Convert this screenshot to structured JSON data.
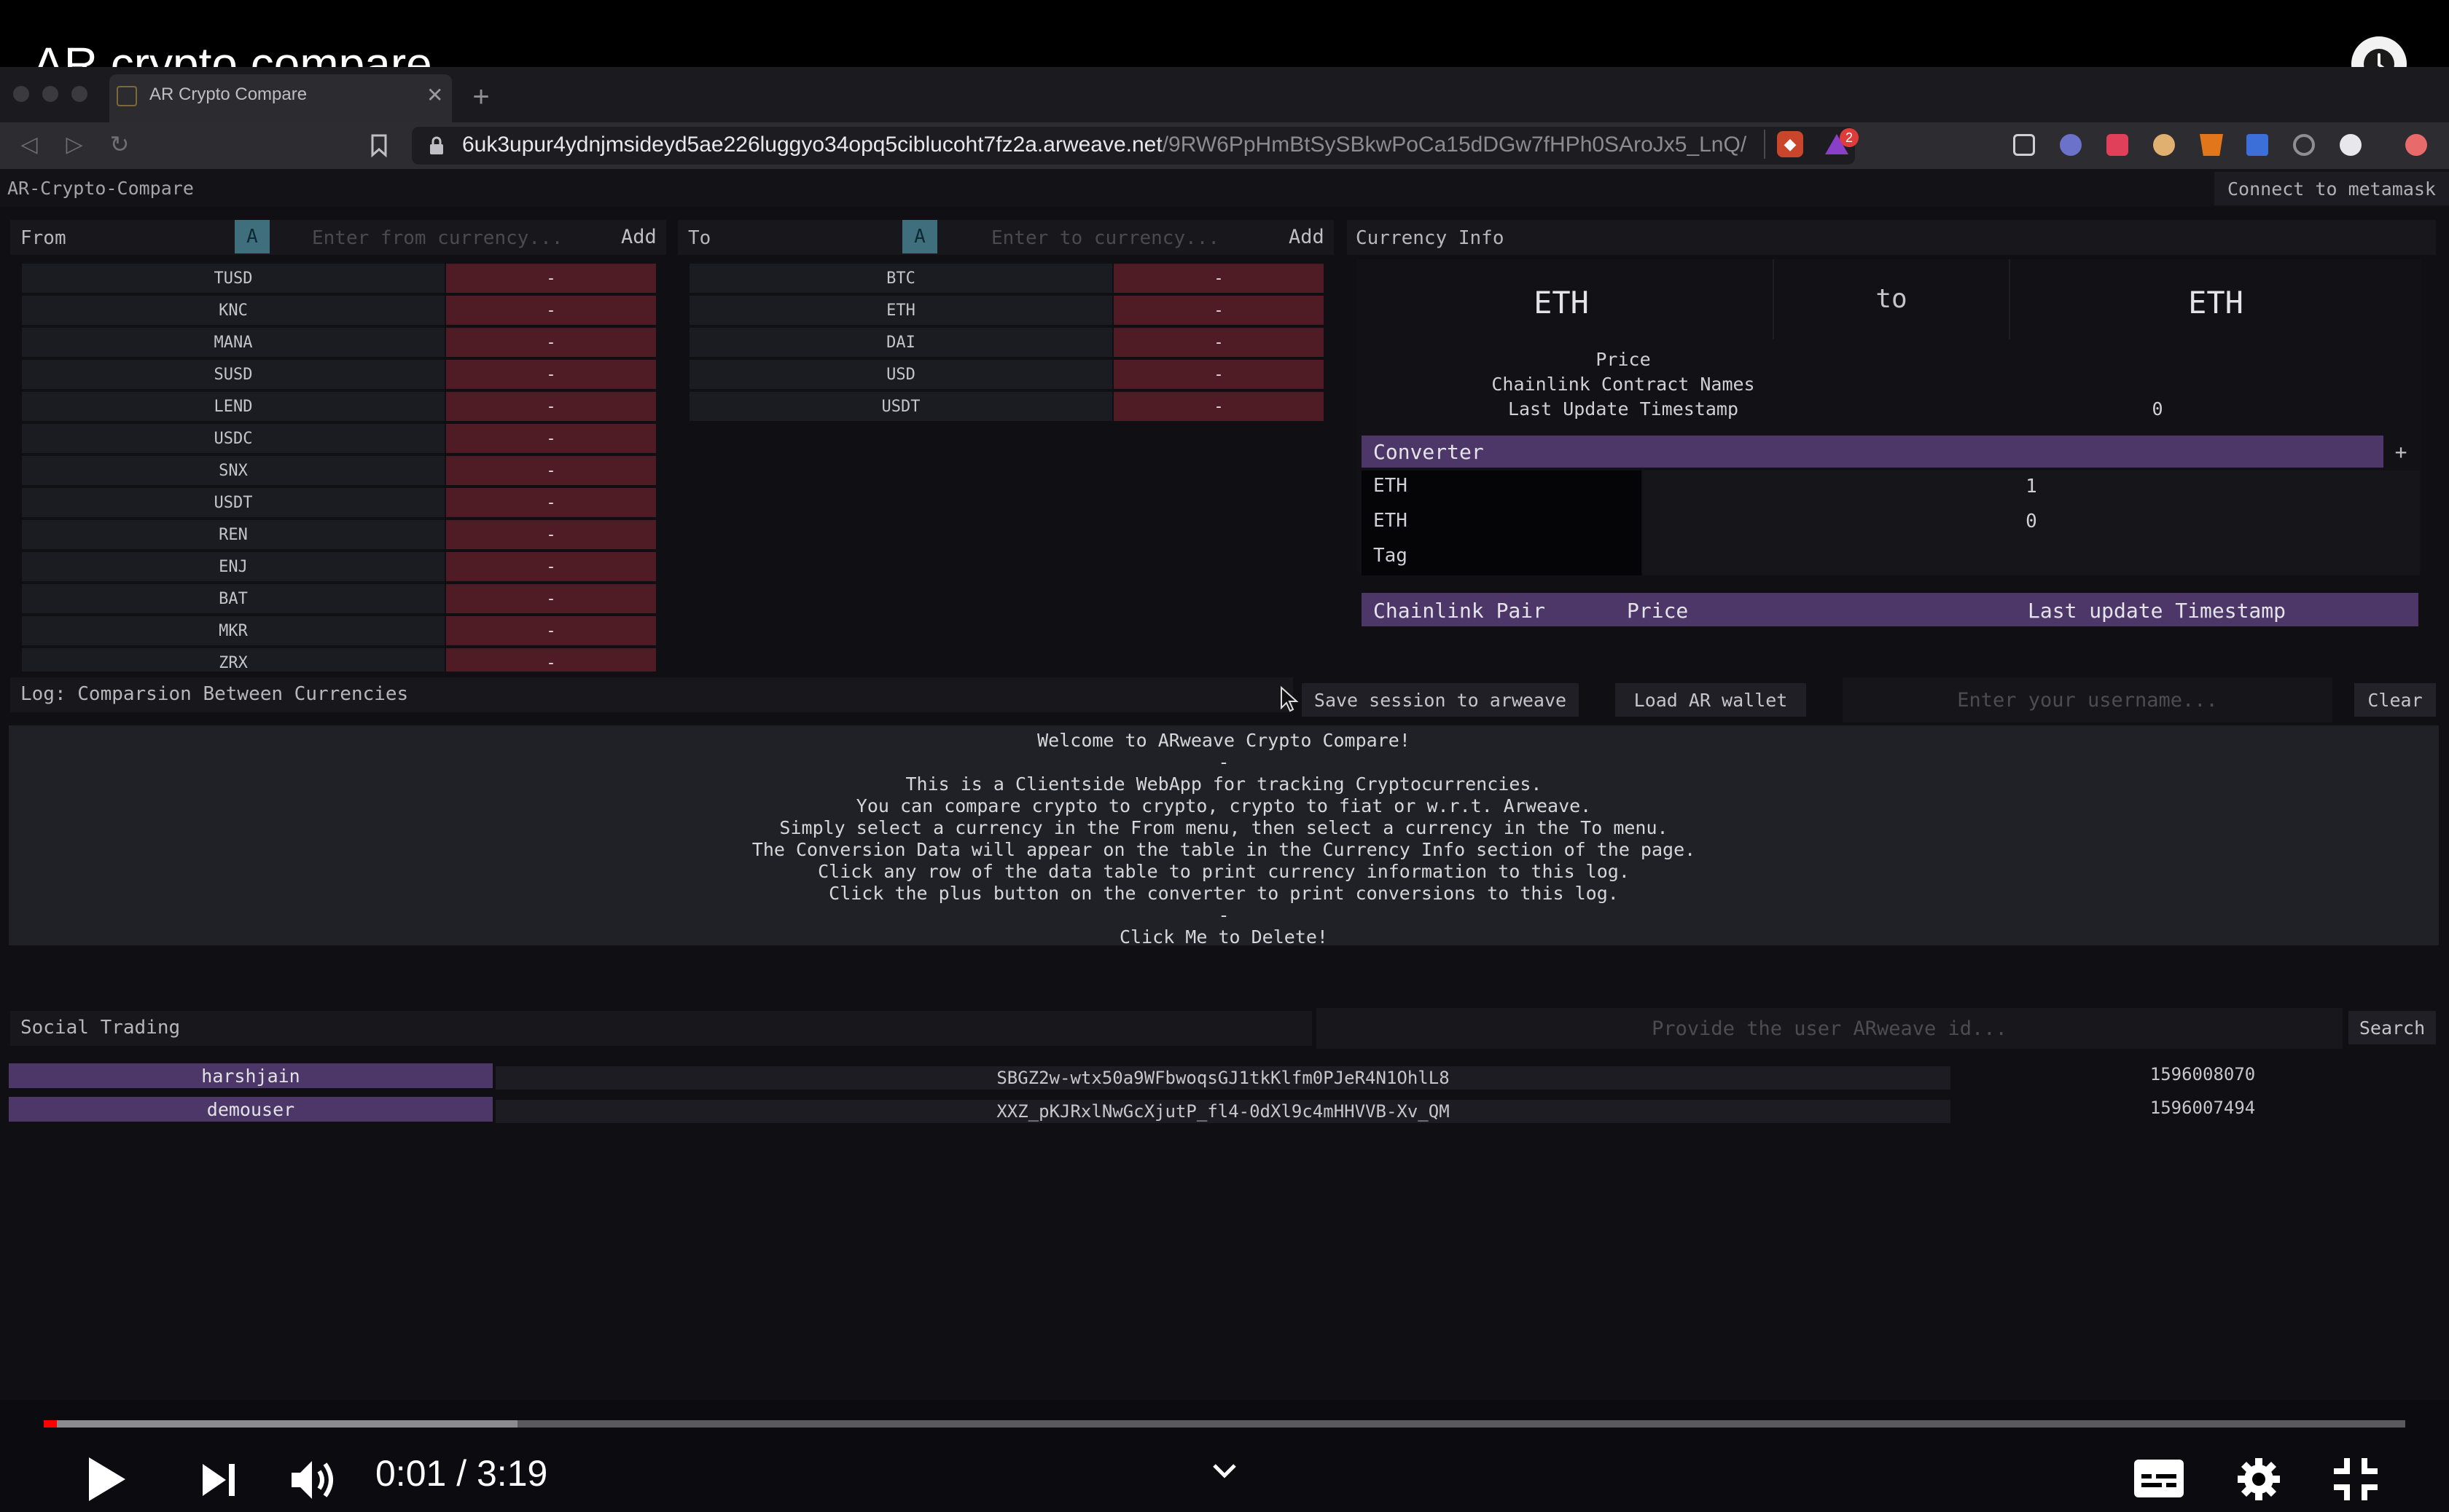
{
  "video": {
    "title": "AR crypto compare",
    "time": "0:01 / 3:19",
    "progress_fraction": 0.005
  },
  "browser": {
    "tab_title": "AR Crypto Compare",
    "url_host": "6uk3upur4ydnjmsideyd5ae226luggyo34opq5ciblucoht7fz2a.arweave.net",
    "url_path": "/9RW6PpHmBtSySBkwPoCa15dDGw7fHPh0SAroJx5_LnQ/",
    "brave_badge": "2"
  },
  "app": {
    "name": "AR-Crypto-Compare",
    "metamask_label": "Connect to metamask"
  },
  "from_panel": {
    "label": "From",
    "a_button": "A",
    "placeholder": "Enter from currency...",
    "add_label": "Add",
    "rows": [
      {
        "name": "TUSD",
        "value": "-"
      },
      {
        "name": "KNC",
        "value": "-"
      },
      {
        "name": "MANA",
        "value": "-"
      },
      {
        "name": "SUSD",
        "value": "-"
      },
      {
        "name": "LEND",
        "value": "-"
      },
      {
        "name": "USDC",
        "value": "-"
      },
      {
        "name": "SNX",
        "value": "-"
      },
      {
        "name": "USDT",
        "value": "-"
      },
      {
        "name": "REN",
        "value": "-"
      },
      {
        "name": "ENJ",
        "value": "-"
      },
      {
        "name": "BAT",
        "value": "-"
      },
      {
        "name": "MKR",
        "value": "-"
      },
      {
        "name": "ZRX",
        "value": "-"
      }
    ]
  },
  "to_panel": {
    "label": "To",
    "a_button": "A",
    "placeholder": "Enter to currency...",
    "add_label": "Add",
    "rows": [
      {
        "name": "BTC",
        "value": "-"
      },
      {
        "name": "ETH",
        "value": "-"
      },
      {
        "name": "DAI",
        "value": "-"
      },
      {
        "name": "USD",
        "value": "-"
      },
      {
        "name": "USDT",
        "value": "-"
      }
    ]
  },
  "currency_info": {
    "label": "Currency Info",
    "from": "ETH",
    "to_word": "to",
    "to": "ETH",
    "price_label": "Price",
    "contract_label": "Chainlink Contract Names",
    "timestamp_label": "Last Update Timestamp",
    "timestamp_value": "0",
    "converter": {
      "label": "Converter",
      "plus": "+",
      "rows": [
        {
          "label": "ETH",
          "value": "1"
        },
        {
          "label": "ETH",
          "value": "0"
        },
        {
          "label": "Tag",
          "value": ""
        }
      ]
    },
    "table_headers": [
      "Chainlink Pair",
      "Price",
      "Last update Timestamp"
    ]
  },
  "log": {
    "label": "Log: Comparsion Between Currencies",
    "save_button": "Save session to arweave",
    "load_button": "Load AR wallet",
    "username_placeholder": "Enter your username...",
    "clear_button": "Clear",
    "lines": [
      "Welcome to ARweave Crypto Compare!",
      "-",
      "This is a Clientside WebApp for tracking Cryptocurrencies.",
      "You can compare crypto to crypto, crypto to fiat or w.r.t. Arweave.",
      "Simply select a currency in the From menu, then select a currency in the To menu.",
      "The Conversion Data will appear on the table in the Currency Info section of the page.",
      "Click any row of the data table to print currency information to this log.",
      "Click the plus button on the converter to print conversions to this log.",
      "-",
      "Click Me to Delete!"
    ]
  },
  "social": {
    "label": "Social Trading",
    "placeholder": "Provide the user ARweave id...",
    "search_button": "Search",
    "rows": [
      {
        "user": "harshjain",
        "id": "SBGZ2w-wtx50a9WFbwoqsGJ1tkKlfm0PJeR4N1OhlL8",
        "timestamp": "1596008070"
      },
      {
        "user": "demouser",
        "id": "XXZ_pKJRxlNwGcXjutP_fl4-0dXl9c4mHHVVB-Xv_QM",
        "timestamp": "1596007494"
      }
    ]
  },
  "colors": {
    "accent_violet": "#4d3768",
    "row_red": "#4f1c26",
    "a_button": "#3f6e7c",
    "progress_red": "#ff0000"
  },
  "icons": [
    "clock-icon",
    "play-icon",
    "next-icon",
    "volume-icon",
    "chevron-down-icon",
    "subtitles-icon",
    "settings-icon",
    "exit-fullscreen-icon",
    "bookmark-icon",
    "lock-icon",
    "back-icon",
    "forward-icon",
    "reload-icon",
    "brave-lion-icon",
    "brave-rewards-icon"
  ]
}
